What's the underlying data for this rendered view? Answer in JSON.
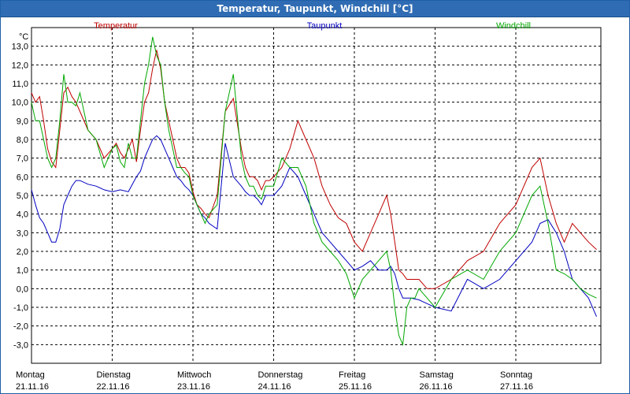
{
  "window": {
    "title": "Temperatur, Taupunkt, Windchill [°C]"
  },
  "chart_data": {
    "type": "line",
    "title": "Temperatur, Taupunkt, Windchill [°C]",
    "ylabel": "°C",
    "ylim": [
      -4.0,
      14.0
    ],
    "yticks": [
      "13,0",
      "12,0",
      "11,0",
      "10,0",
      "9,0",
      "8,0",
      "7,0",
      "6,0",
      "5,0",
      "4,0",
      "3,0",
      "2,0",
      "1,0",
      "0,0",
      "-1,0",
      "-2,0",
      "-3,0"
    ],
    "ytick_values": [
      13,
      12,
      11,
      10,
      9,
      8,
      7,
      6,
      5,
      4,
      3,
      2,
      1,
      0,
      -1,
      -2,
      -3
    ],
    "xlim": [
      0,
      7
    ],
    "x_days": [
      {
        "day": "Montag",
        "date": "21.11.16"
      },
      {
        "day": "Dienstag",
        "date": "22.11.16"
      },
      {
        "day": "Mittwoch",
        "date": "23.11.16"
      },
      {
        "day": "Donnerstag",
        "date": "24.11.16"
      },
      {
        "day": "Freitag",
        "date": "25.11.16"
      },
      {
        "day": "Samstag",
        "date": "26.11.16"
      },
      {
        "day": "Sonntag",
        "date": "27.11.16"
      }
    ],
    "grid": true,
    "legend": "top",
    "series": [
      {
        "name": "Temperatur",
        "color": "#c00000",
        "x": [
          0.0,
          0.05,
          0.1,
          0.15,
          0.2,
          0.25,
          0.3,
          0.35,
          0.4,
          0.45,
          0.5,
          0.55,
          0.6,
          0.7,
          0.8,
          0.9,
          1.0,
          1.05,
          1.1,
          1.15,
          1.2,
          1.25,
          1.3,
          1.35,
          1.4,
          1.45,
          1.5,
          1.55,
          1.6,
          1.65,
          1.7,
          1.75,
          1.8,
          1.85,
          1.9,
          1.95,
          2.0,
          2.05,
          2.1,
          2.15,
          2.2,
          2.3,
          2.4,
          2.5,
          2.6,
          2.65,
          2.7,
          2.75,
          2.8,
          2.85,
          2.9,
          2.95,
          3.0,
          3.1,
          3.2,
          3.3,
          3.4,
          3.5,
          3.6,
          3.7,
          3.8,
          3.9,
          4.0,
          4.1,
          4.2,
          4.3,
          4.4,
          4.45,
          4.5,
          4.55,
          4.6,
          4.65,
          4.7,
          4.75,
          4.8,
          4.9,
          5.0,
          5.2,
          5.4,
          5.6,
          5.8,
          6.0,
          6.2,
          6.3,
          6.4,
          6.5,
          6.6,
          6.7,
          6.8,
          6.9,
          7.0
        ],
        "values": [
          10.5,
          10.0,
          10.3,
          9.0,
          7.5,
          6.8,
          6.5,
          8.5,
          10.5,
          10.8,
          10.3,
          10.0,
          9.5,
          8.5,
          8.0,
          7.0,
          7.5,
          7.8,
          7.3,
          7.0,
          7.5,
          8.0,
          6.8,
          8.5,
          10.0,
          10.5,
          11.8,
          12.8,
          11.8,
          10.0,
          9.0,
          8.0,
          7.0,
          6.5,
          6.5,
          6.2,
          5.2,
          4.5,
          4.3,
          4.0,
          3.8,
          5.0,
          9.5,
          10.2,
          7.5,
          6.5,
          6.0,
          6.0,
          5.8,
          5.3,
          5.8,
          5.8,
          6.0,
          6.5,
          7.5,
          9.0,
          8.0,
          7.0,
          5.5,
          4.5,
          3.8,
          3.5,
          2.5,
          2.0,
          3.0,
          4.0,
          5.0,
          4.0,
          2.5,
          1.0,
          0.8,
          0.5,
          0.5,
          0.5,
          0.5,
          0.0,
          0.0,
          0.5,
          1.5,
          2.0,
          3.5,
          4.5,
          6.5,
          7.0,
          5.0,
          3.5,
          2.5,
          3.5,
          3.0,
          2.5,
          2.1
        ]
      },
      {
        "name": "Taupunkt",
        "color": "#0000c0",
        "x": [
          0.0,
          0.05,
          0.1,
          0.15,
          0.2,
          0.25,
          0.3,
          0.35,
          0.4,
          0.45,
          0.5,
          0.55,
          0.6,
          0.7,
          0.8,
          0.9,
          1.0,
          1.1,
          1.2,
          1.3,
          1.35,
          1.4,
          1.45,
          1.5,
          1.55,
          1.6,
          1.65,
          1.7,
          1.75,
          1.8,
          1.85,
          1.9,
          1.95,
          2.0,
          2.05,
          2.1,
          2.15,
          2.2,
          2.3,
          2.4,
          2.5,
          2.6,
          2.65,
          2.7,
          2.75,
          2.8,
          2.85,
          2.9,
          2.95,
          3.0,
          3.1,
          3.2,
          3.3,
          3.4,
          3.5,
          3.6,
          3.7,
          3.8,
          3.9,
          4.0,
          4.1,
          4.2,
          4.3,
          4.4,
          4.45,
          4.5,
          4.55,
          4.6,
          4.7,
          4.8,
          4.9,
          5.0,
          5.2,
          5.4,
          5.6,
          5.8,
          6.0,
          6.2,
          6.3,
          6.4,
          6.5,
          6.6,
          6.7,
          6.8,
          6.9,
          7.0
        ],
        "values": [
          5.3,
          4.5,
          3.8,
          3.5,
          3.0,
          2.5,
          2.5,
          3.2,
          4.5,
          5.0,
          5.5,
          5.8,
          5.8,
          5.6,
          5.5,
          5.3,
          5.2,
          5.3,
          5.2,
          6.0,
          6.3,
          7.0,
          7.5,
          8.0,
          8.2,
          8.0,
          7.5,
          7.0,
          6.5,
          6.0,
          5.8,
          5.5,
          5.3,
          5.0,
          4.5,
          4.0,
          3.8,
          3.5,
          3.2,
          7.8,
          6.0,
          5.5,
          5.2,
          5.0,
          5.0,
          4.8,
          4.5,
          5.0,
          5.0,
          5.0,
          5.5,
          6.5,
          6.0,
          5.0,
          4.0,
          3.0,
          2.5,
          2.0,
          1.5,
          1.0,
          1.2,
          1.5,
          1.0,
          1.0,
          1.2,
          0.8,
          0.0,
          -0.5,
          -0.5,
          -0.6,
          -0.8,
          -1.0,
          -1.2,
          0.5,
          0.0,
          0.5,
          1.5,
          2.5,
          3.5,
          3.7,
          3.0,
          2.0,
          0.5,
          0.0,
          -0.5,
          -1.5
        ]
      },
      {
        "name": "Windchill",
        "color": "#00a800",
        "x": [
          0.0,
          0.05,
          0.1,
          0.15,
          0.2,
          0.25,
          0.3,
          0.35,
          0.4,
          0.45,
          0.5,
          0.55,
          0.6,
          0.7,
          0.8,
          0.9,
          1.0,
          1.05,
          1.1,
          1.15,
          1.2,
          1.25,
          1.3,
          1.35,
          1.4,
          1.45,
          1.5,
          1.55,
          1.6,
          1.65,
          1.7,
          1.75,
          1.8,
          1.85,
          1.9,
          1.95,
          2.0,
          2.05,
          2.1,
          2.15,
          2.2,
          2.3,
          2.4,
          2.5,
          2.6,
          2.65,
          2.7,
          2.75,
          2.8,
          2.85,
          2.9,
          2.95,
          3.0,
          3.1,
          3.2,
          3.3,
          3.4,
          3.5,
          3.6,
          3.7,
          3.8,
          3.9,
          4.0,
          4.1,
          4.2,
          4.3,
          4.4,
          4.45,
          4.5,
          4.55,
          4.6,
          4.65,
          4.7,
          4.75,
          4.8,
          4.9,
          5.0,
          5.2,
          5.4,
          5.6,
          5.8,
          6.0,
          6.2,
          6.3,
          6.4,
          6.5,
          6.6,
          6.7,
          6.8,
          6.9,
          7.0
        ],
        "values": [
          10.0,
          9.0,
          9.0,
          8.0,
          7.0,
          6.5,
          7.0,
          9.0,
          11.5,
          10.0,
          10.0,
          9.8,
          10.5,
          8.5,
          8.0,
          6.5,
          7.5,
          7.7,
          6.8,
          6.5,
          7.8,
          7.0,
          7.0,
          9.0,
          11.0,
          12.0,
          13.5,
          12.5,
          12.0,
          10.0,
          8.5,
          7.5,
          6.5,
          6.5,
          6.2,
          6.0,
          5.0,
          4.5,
          4.0,
          3.5,
          4.0,
          4.5,
          9.5,
          11.5,
          7.0,
          6.0,
          5.5,
          5.5,
          5.0,
          4.8,
          5.5,
          5.5,
          5.5,
          7.0,
          6.5,
          6.5,
          5.5,
          3.5,
          2.5,
          2.0,
          1.5,
          0.8,
          -0.5,
          0.5,
          1.0,
          1.5,
          2.0,
          1.0,
          -1.0,
          -2.5,
          -3.0,
          -1.0,
          -0.5,
          -0.5,
          0.0,
          -0.5,
          -1.0,
          0.5,
          1.0,
          0.5,
          2.0,
          3.0,
          5.0,
          5.5,
          3.5,
          1.0,
          0.8,
          0.5,
          0.0,
          -0.3,
          -0.5
        ]
      }
    ]
  }
}
